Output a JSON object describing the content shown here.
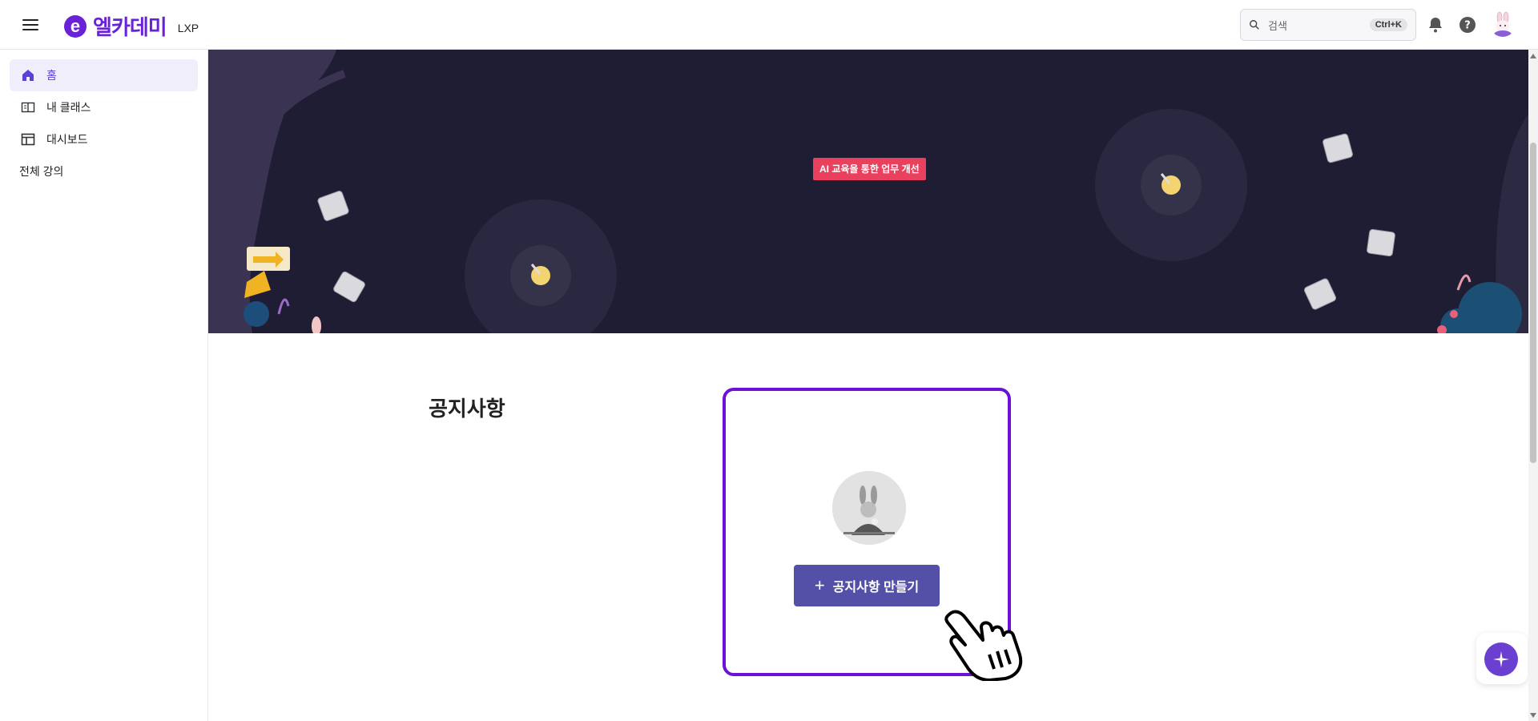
{
  "header": {
    "logo_mark": "e",
    "logo_text": "엘카데미",
    "logo_sub": "LXP",
    "search_placeholder": "검색",
    "search_shortcut": "Ctrl+K"
  },
  "sidebar": {
    "items": [
      {
        "label": "홈",
        "icon": "home-icon",
        "active": true
      },
      {
        "label": "내 클래스",
        "icon": "book-icon"
      },
      {
        "label": "대시보드",
        "icon": "dashboard-icon"
      }
    ],
    "all_courses": "전체 강의"
  },
  "banner": {
    "badge": "AI 교육을 통한 업무 개선"
  },
  "notice": {
    "title": "공지사항",
    "create_button": "공지사항 만들기"
  },
  "colors": {
    "brand": "#6a22d8",
    "banner_bg": "#1f1d34",
    "badge": "#e8405d",
    "button": "#5450a8",
    "card_border": "#6a12d6"
  }
}
